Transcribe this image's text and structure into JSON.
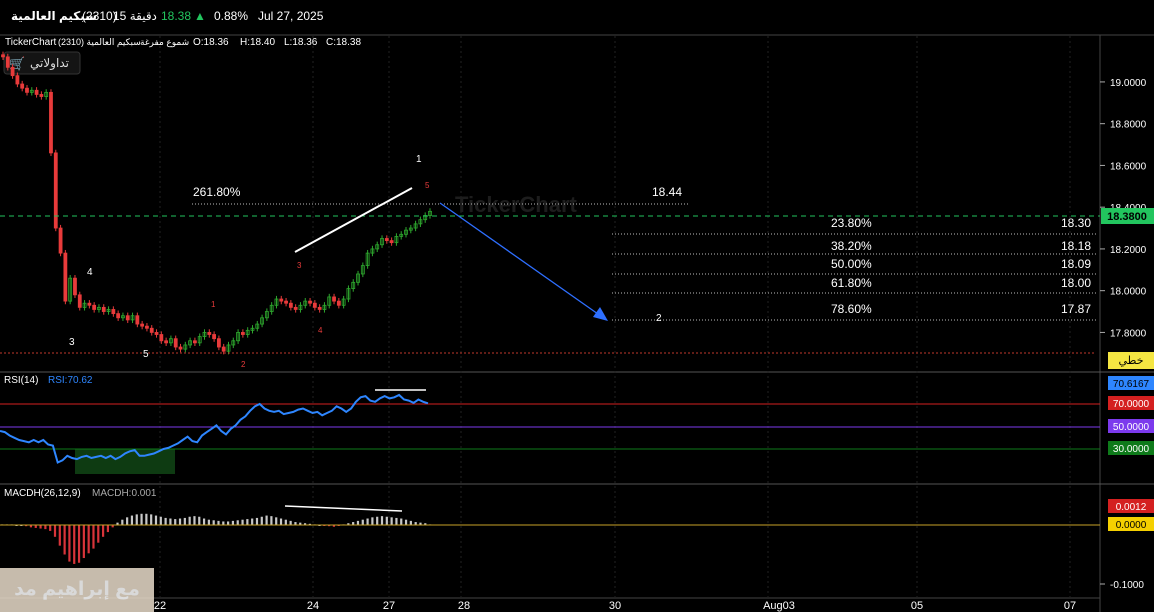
{
  "header": {
    "symbol_name": "سبكيم العالمية",
    "symbol_code": "(2310)",
    "interval": "15 دقيقة",
    "last_price": "18.38",
    "change_pct": "0.88%",
    "date": "Jul 27, 2025"
  },
  "chart_info": {
    "source": "TickerChart",
    "symbol": "سبكيم العالمية (2310)",
    "candle_type": "شموع مفرغة",
    "open": "O:18.36",
    "high": "H:18.40",
    "low": "L:18.36",
    "close": "C:18.38",
    "logo_text": "تداولاتي",
    "watermark": "TickerChart",
    "style_label": "خطي",
    "author_watermark": "مع إبراهيم مد"
  },
  "colors": {
    "up": "#2ea82e",
    "down": "#e83b3b",
    "rsi": "#2e86ff",
    "last_price_tag": "#22c55e",
    "overbought": "#d42020",
    "mid": "#7c3aed",
    "oversold": "#0e7a1a"
  },
  "chart_data": [
    {
      "type": "candlestick",
      "title": "سبكيم العالمية (2310) – 15 دقيقة",
      "ylim": [
        17.62,
        19.22
      ],
      "y_ticks": [
        "19.0000",
        "18.8000",
        "18.6000",
        "18.4000",
        "18.2000",
        "18.0000",
        "17.8000"
      ],
      "x_ticks": [
        "22",
        "24",
        "27",
        "28",
        "30",
        "Aug03",
        "05",
        "07"
      ],
      "last_price": "18.3800",
      "fibonacci": {
        "extension": {
          "label": "261.80%",
          "value": "18.44"
        },
        "levels": [
          {
            "pct": "23.80%",
            "value": "18.30"
          },
          {
            "pct": "38.20%",
            "value": "18.18"
          },
          {
            "pct": "50.00%",
            "value": "18.09"
          },
          {
            "pct": "61.80%",
            "value": "18.00"
          },
          {
            "pct": "78.60%",
            "value": "17.87"
          }
        ]
      },
      "wave_labels": [
        "1",
        "2",
        "3",
        "4",
        "5"
      ],
      "close_series": [
        19.12,
        19.07,
        19.03,
        18.99,
        18.97,
        18.95,
        18.96,
        18.94,
        18.93,
        18.95,
        18.66,
        18.3,
        18.18,
        17.95,
        18.06,
        17.98,
        17.92,
        17.94,
        17.93,
        17.91,
        17.92,
        17.9,
        17.91,
        17.89,
        17.87,
        17.88,
        17.86,
        17.88,
        17.84,
        17.83,
        17.82,
        17.8,
        17.79,
        17.76,
        17.75,
        17.77,
        17.73,
        17.72,
        17.74,
        17.76,
        17.75,
        17.78,
        17.8,
        17.79,
        17.77,
        17.73,
        17.71,
        17.74,
        17.76,
        17.8,
        17.79,
        17.81,
        17.82,
        17.84,
        17.87,
        17.9,
        17.93,
        17.96,
        17.95,
        17.94,
        17.92,
        17.91,
        17.93,
        17.95,
        17.94,
        17.92,
        17.91,
        17.93,
        17.97,
        17.95,
        17.93,
        17.96,
        18.01,
        18.04,
        18.08,
        18.12,
        18.18,
        18.2,
        18.22,
        18.25,
        18.24,
        18.23,
        18.26,
        18.27,
        18.29,
        18.3,
        18.32,
        18.34,
        18.36,
        18.38
      ]
    },
    {
      "type": "line",
      "title": "RSI(14)",
      "value_label": "RSI:70.62",
      "ylim": [
        0,
        100
      ],
      "levels": [
        "70.0000",
        "50.0000",
        "30.0000"
      ],
      "last_value": "70.6167",
      "series": [
        {
          "values": [
            46,
            45,
            42,
            40,
            38,
            37,
            36,
            38,
            36,
            38,
            34,
            33,
            18,
            20,
            24,
            22,
            21,
            23,
            24,
            22,
            23,
            24,
            22,
            24,
            21,
            23,
            26,
            28,
            29,
            24,
            24,
            25,
            26,
            28,
            30,
            31,
            33,
            35,
            38,
            41,
            37,
            36,
            42,
            45,
            48,
            51,
            46,
            43,
            48,
            51,
            56,
            59,
            64,
            68,
            70,
            66,
            64,
            63,
            64,
            61,
            62,
            63,
            65,
            66,
            64,
            62,
            63,
            60,
            62,
            64,
            68,
            66,
            63,
            66,
            72,
            76,
            77,
            73,
            72,
            75,
            77,
            75,
            76,
            78,
            74,
            73,
            71,
            74,
            72,
            70.62
          ]
        }
      ]
    },
    {
      "type": "bar",
      "title": "MACDH(26,12,9)",
      "value_label": "MACDH:0.001",
      "ylim": [
        -0.11,
        0.02
      ],
      "last_value": "0.0012",
      "zero_label": "0.0000",
      "y_ticks": [
        "-0.1000"
      ],
      "values": [
        0.001,
        0.001,
        0.001,
        0,
        0,
        -0.002,
        -0.004,
        -0.005,
        -0.006,
        -0.007,
        -0.01,
        -0.02,
        -0.035,
        -0.05,
        -0.062,
        -0.066,
        -0.064,
        -0.056,
        -0.048,
        -0.04,
        -0.03,
        -0.02,
        -0.012,
        -0.004,
        0.004,
        0.009,
        0.013,
        0.016,
        0.018,
        0.019,
        0.019,
        0.018,
        0.016,
        0.014,
        0.012,
        0.011,
        0.01,
        0.011,
        0.012,
        0.014,
        0.015,
        0.014,
        0.011,
        0.009,
        0.008,
        0.007,
        0.006,
        0.006,
        0.007,
        0.008,
        0.009,
        0.01,
        0.011,
        0.012,
        0.014,
        0.016,
        0.015,
        0.013,
        0.011,
        0.009,
        0.007,
        0.005,
        0.004,
        0.003,
        0.002,
        0.001,
        0,
        -0.001,
        -0.002,
        -0.003,
        -0.001,
        0.001,
        0.003,
        0.005,
        0.007,
        0.009,
        0.011,
        0.013,
        0.014,
        0.015,
        0.014,
        0.013,
        0.012,
        0.011,
        0.009,
        0.007,
        0.005,
        0.004,
        0.003,
        0.001
      ]
    }
  ]
}
